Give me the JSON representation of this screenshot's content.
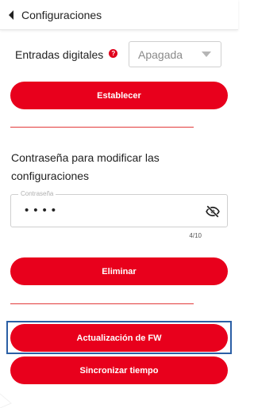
{
  "header": {
    "title": "Configuraciones",
    "back_icon": "chevron-left-icon"
  },
  "digital_inputs": {
    "label": "Entradas digitales",
    "help_icon_glyph": "?",
    "select_value": "Apagada"
  },
  "buttons": {
    "set": "Establecer",
    "delete": "Eliminar",
    "fw_update": "Actualización de FW",
    "sync_time": "Sincronizar tiempo"
  },
  "password_section": {
    "description": "Contraseña para modificar las configuraciones",
    "field_label": "Contraseña",
    "field_value": "••••",
    "counter": "4/10",
    "visibility_icon": "eye-off-icon"
  },
  "colors": {
    "accent": "#e8001c",
    "divider": "#e23a3a",
    "highlight": "#2b5fa5"
  }
}
